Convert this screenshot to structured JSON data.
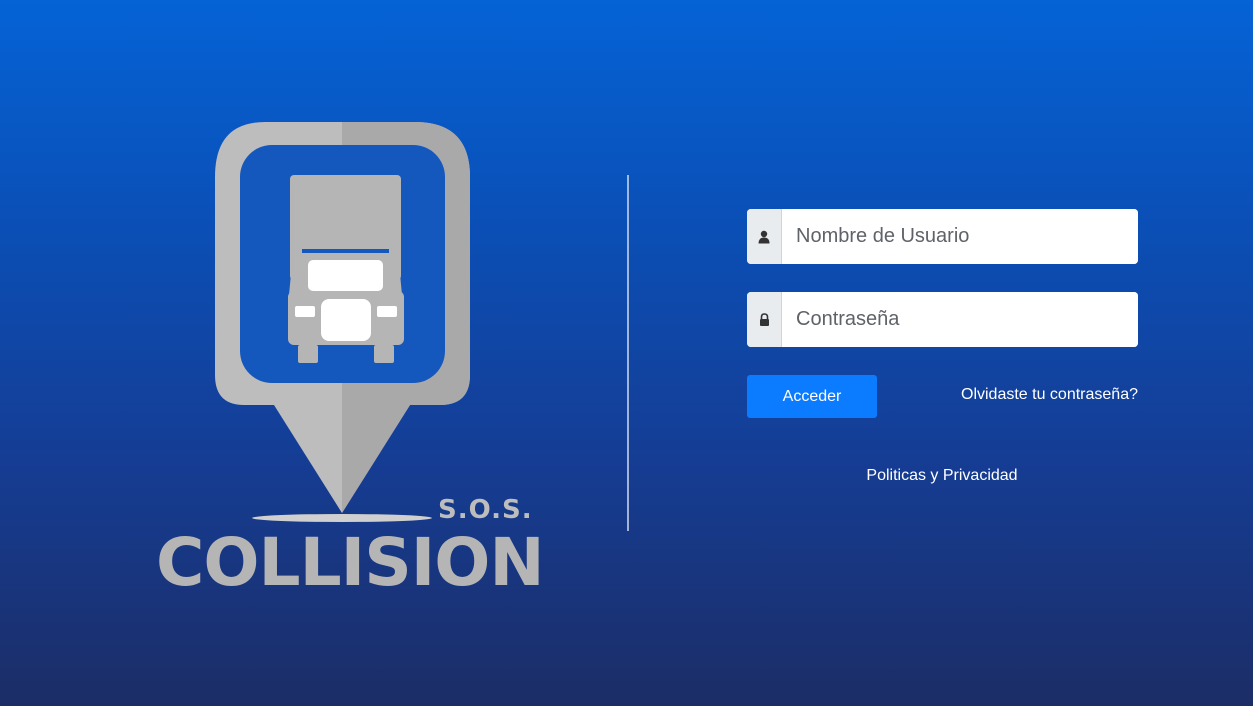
{
  "brand": {
    "subtitle": "S.O.S.",
    "name": "COLLISION"
  },
  "login": {
    "username_placeholder": "Nombre de Usuario",
    "username_value": "",
    "username_icon": "user-icon",
    "password_placeholder": "Contraseña",
    "password_value": "",
    "password_icon": "lock-icon",
    "submit_label": "Acceder",
    "forgot_label": "Olvidaste tu contraseña?",
    "privacy_label": "Politicas y Privacidad"
  },
  "colors": {
    "background_top": "#0563d6",
    "background_bottom": "#1c2d66",
    "primary_button": "#0b7bff",
    "logo_gray": "#b5b5b5"
  }
}
